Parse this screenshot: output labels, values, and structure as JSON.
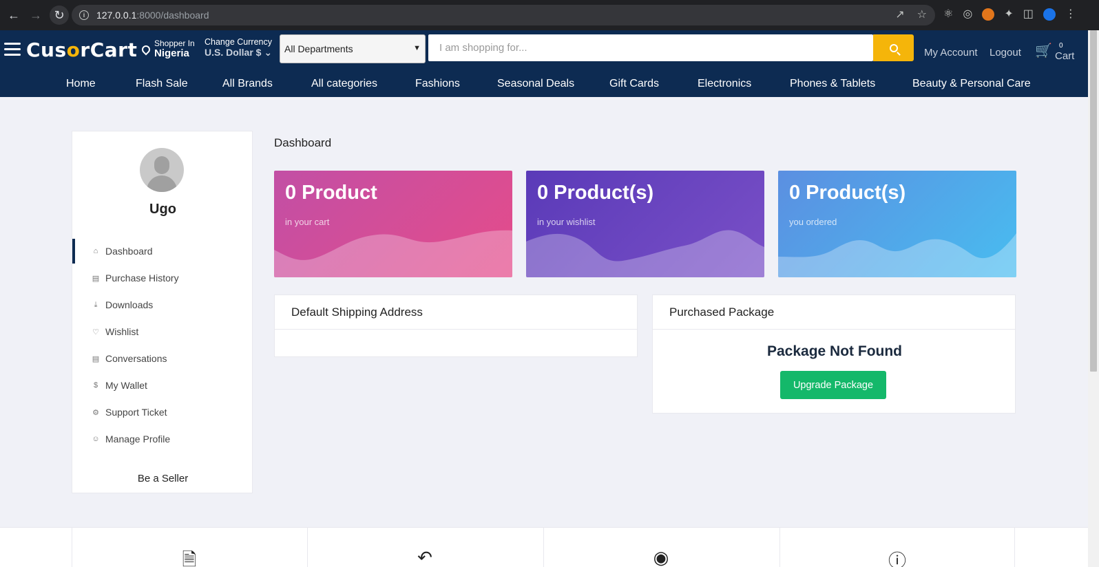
{
  "browser": {
    "url_host": "127.0.0.1",
    "url_path": ":8000/dashboard"
  },
  "header": {
    "logo_pre": "Cus",
    "logo_o": "o",
    "logo_post": "rCart",
    "shopper_label": "Shopper In",
    "shopper_value": "Nigeria",
    "currency_label": "Change Currency",
    "currency_value": "U.S. Dollar $",
    "department": "All Departments",
    "search_placeholder": "I am shopping for...",
    "my_account": "My Account",
    "logout": "Logout",
    "cart_count": "0",
    "cart_label": "Cart",
    "accent_color": "#f5b50a",
    "brand_color": "#0d2b52"
  },
  "menu": [
    "Home",
    "Flash Sale",
    "All Brands",
    "All categories",
    "Fashions",
    "Seasonal Deals",
    "Gift Cards",
    "Electronics",
    "Phones & Tablets",
    "Beauty & Personal Care"
  ],
  "sidebar": {
    "username": "Ugo",
    "items": [
      {
        "label": "Dashboard",
        "icon": "home-icon"
      },
      {
        "label": "Purchase History",
        "icon": "document-icon"
      },
      {
        "label": "Downloads",
        "icon": "download-icon"
      },
      {
        "label": "Wishlist",
        "icon": "heart-icon"
      },
      {
        "label": "Conversations",
        "icon": "chat-icon"
      },
      {
        "label": "My Wallet",
        "icon": "dollar-icon"
      },
      {
        "label": "Support Ticket",
        "icon": "support-icon"
      },
      {
        "label": "Manage Profile",
        "icon": "user-icon"
      }
    ],
    "be_a_seller": "Be a Seller"
  },
  "main": {
    "title": "Dashboard",
    "stats": [
      {
        "value": "0 Product",
        "caption": "in your cart"
      },
      {
        "value": "0 Product(s)",
        "caption": "in your wishlist"
      },
      {
        "value": "0 Product(s)",
        "caption": "you ordered"
      }
    ],
    "shipping_title": "Default Shipping Address",
    "package_title": "Purchased Package",
    "package_not_found": "Package Not Found",
    "upgrade_button": "Upgrade Package",
    "upgrade_color": "#14b86a"
  },
  "footer_icons": [
    "document-icon",
    "return-icon",
    "lifebuoy-icon",
    "alert-icon"
  ]
}
